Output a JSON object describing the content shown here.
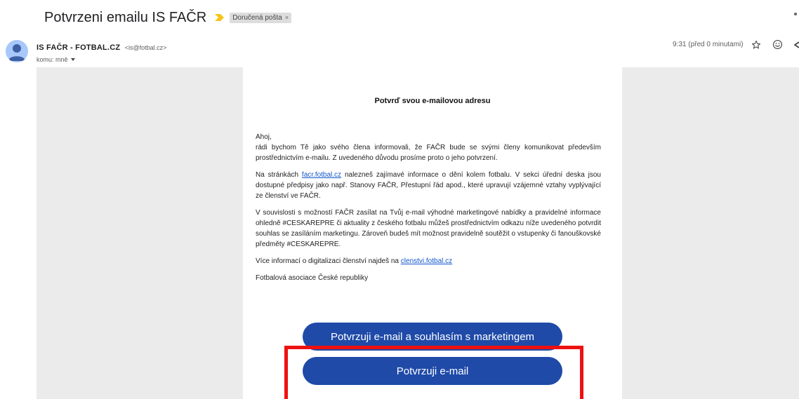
{
  "subject": "Potvrzeni emailu IS FAČR",
  "label_chip": {
    "text": "Doručená pošta",
    "close": "×"
  },
  "sender": {
    "name": "IS FAČR - FOTBAL.CZ",
    "email": "<is@fotbal.cz>",
    "recipient": "komu: mně"
  },
  "timestamp": "9:31 (před 0 minutami)",
  "icons": {
    "importance": "importance-marker-icon",
    "avatar": "person-avatar-icon",
    "star": "star-icon",
    "emoji": "emoji-icon",
    "reply": "reply-icon"
  },
  "colors": {
    "button_bg": "#1f4aa8",
    "link": "#1155cc",
    "highlight": "#ee1111",
    "importance": "#f5c518",
    "avatar_bg": "#a8c7fa"
  },
  "email": {
    "title": "Potvrď svou e-mailovou adresu",
    "greeting": "Ahoj,",
    "p1": "rádi bychom Tě jako svého člena informovali, že FAČR bude se svými členy komunikovat především prostřednictvím e-mailu. Z uvedeného důvodu prosíme proto o jeho potvrzení.",
    "p2_before": "Na stránkách ",
    "p2_link": "facr.fotbal.cz",
    "p2_after": " nalezneš zajímavé informace o dění kolem fotbalu. V sekci úřední deska jsou dostupné předpisy jako např. Stanovy FAČR, Přestupní řád apod., které upravují vzájemné vztahy vyplývající ze členství ve FAČR.",
    "p3": "V souvislosti s možností FAČR zasílat na Tvůj e-mail výhodné marketingové nabídky a pravidelné informace ohledně #CESKAREPRE či aktuality z českého fotbalu můžeš prostřednictvím odkazu níže uvedeného potvrdit souhlas se zasíláním marketingu. Zároveň budeš mít možnost pravidelně soutěžit o vstupenky či fanouškovské předměty #CESKAREPRE.",
    "p4_before": "Více informací o digitalizaci členství najdeš na ",
    "p4_link": "clenstvi.fotbal.cz",
    "signature": "Fotbalová asociace České republiky"
  },
  "buttons": {
    "marketing": "Potvrzuji e-mail a souhlasím s marketingem",
    "email": "Potvrzuji e-mail"
  }
}
